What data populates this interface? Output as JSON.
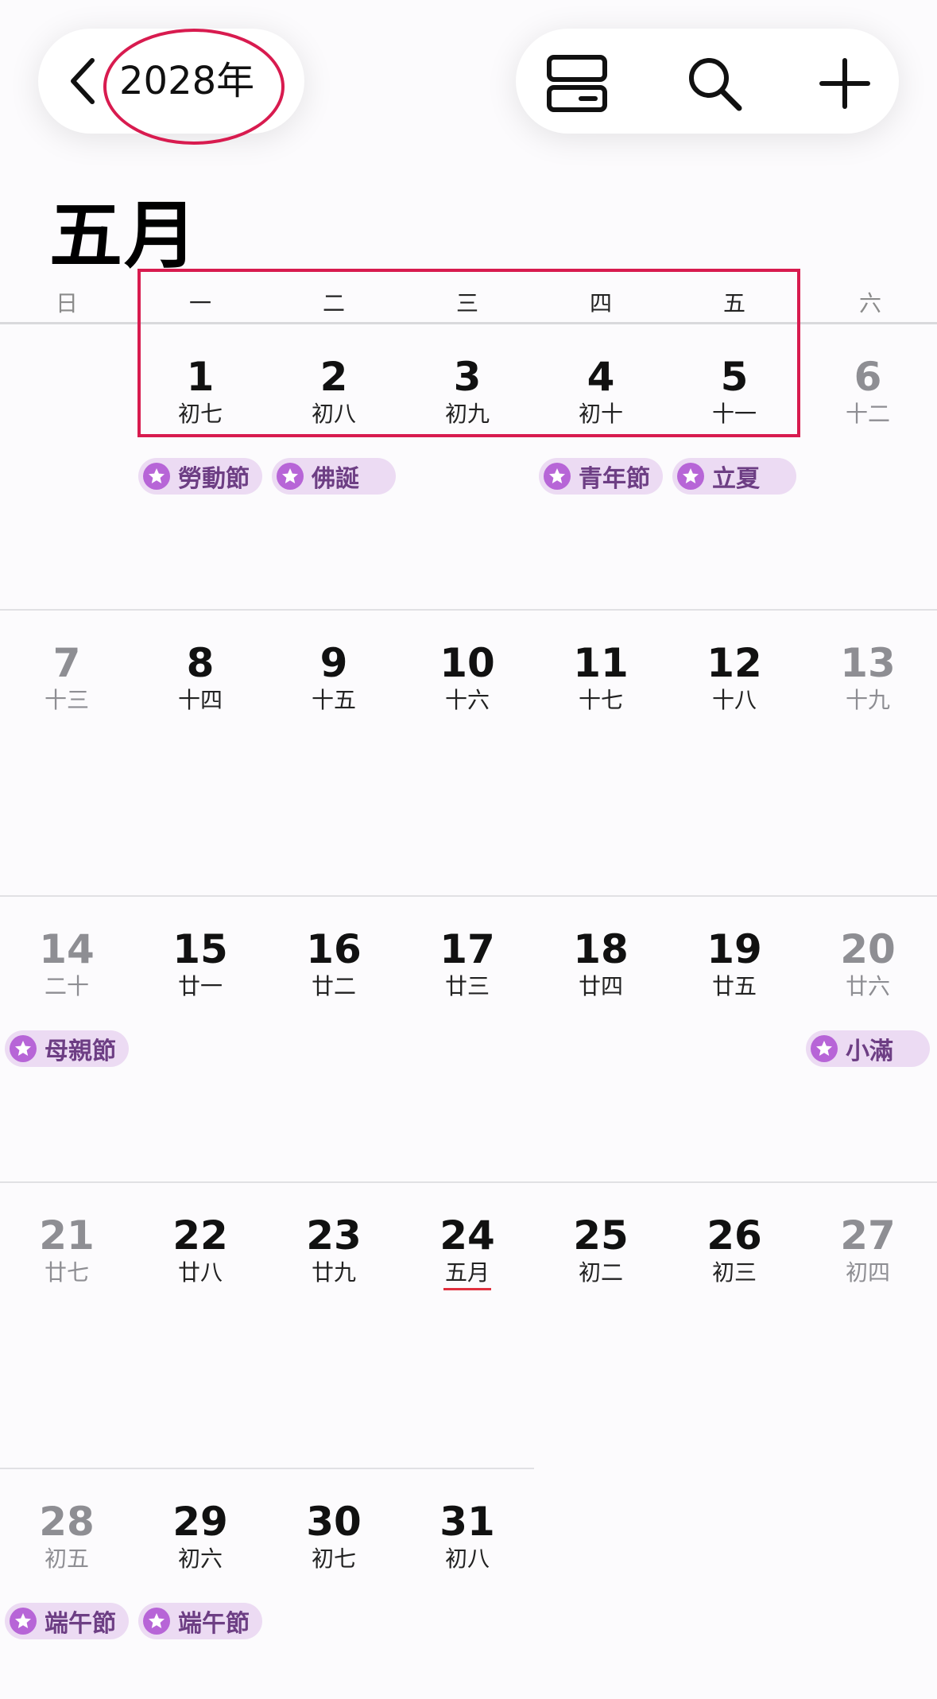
{
  "header": {
    "year_label": "2028年",
    "back_icon": "chevron-left-icon",
    "list_view_icon": "list-view-icon",
    "search_icon": "search-icon",
    "add_icon": "plus-icon"
  },
  "month": {
    "title": "五月"
  },
  "weekdays": [
    "日",
    "一",
    "二",
    "三",
    "四",
    "五",
    "六"
  ],
  "days": [
    {
      "num": "1",
      "lunar": "初七"
    },
    {
      "num": "2",
      "lunar": "初八"
    },
    {
      "num": "3",
      "lunar": "初九"
    },
    {
      "num": "4",
      "lunar": "初十"
    },
    {
      "num": "5",
      "lunar": "十一"
    },
    {
      "num": "6",
      "lunar": "十二"
    },
    {
      "num": "7",
      "lunar": "十三"
    },
    {
      "num": "8",
      "lunar": "十四"
    },
    {
      "num": "9",
      "lunar": "十五"
    },
    {
      "num": "10",
      "lunar": "十六"
    },
    {
      "num": "11",
      "lunar": "十七"
    },
    {
      "num": "12",
      "lunar": "十八"
    },
    {
      "num": "13",
      "lunar": "十九"
    },
    {
      "num": "14",
      "lunar": "二十"
    },
    {
      "num": "15",
      "lunar": "廿一"
    },
    {
      "num": "16",
      "lunar": "廿二"
    },
    {
      "num": "17",
      "lunar": "廿三"
    },
    {
      "num": "18",
      "lunar": "廿四"
    },
    {
      "num": "19",
      "lunar": "廿五"
    },
    {
      "num": "20",
      "lunar": "廿六"
    },
    {
      "num": "21",
      "lunar": "廿七"
    },
    {
      "num": "22",
      "lunar": "廿八"
    },
    {
      "num": "23",
      "lunar": "廿九"
    },
    {
      "num": "24",
      "lunar": "五月"
    },
    {
      "num": "25",
      "lunar": "初二"
    },
    {
      "num": "26",
      "lunar": "初三"
    },
    {
      "num": "27",
      "lunar": "初四"
    },
    {
      "num": "28",
      "lunar": "初五"
    },
    {
      "num": "29",
      "lunar": "初六"
    },
    {
      "num": "30",
      "lunar": "初七"
    },
    {
      "num": "31",
      "lunar": "初八"
    }
  ],
  "holidays": [
    {
      "day": "1",
      "label": "勞動節"
    },
    {
      "day": "2",
      "label": "佛誕"
    },
    {
      "day": "4",
      "label": "青年節"
    },
    {
      "day": "5",
      "label": "立夏"
    },
    {
      "day": "14",
      "label": "母親節"
    },
    {
      "day": "20",
      "label": "小滿"
    },
    {
      "day": "28",
      "label": "端午節"
    },
    {
      "day": "29",
      "label": "端午節"
    }
  ],
  "today": "24",
  "colors": {
    "accent": "#d81b4f",
    "holiday_chip_bg": "#ecdbf3",
    "holiday_star": "#b765d7",
    "holiday_text": "#6d3e84",
    "weekend_text": "#8e8e93",
    "today_underline": "#e0303e"
  }
}
